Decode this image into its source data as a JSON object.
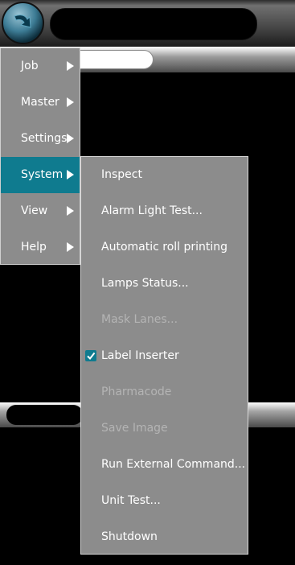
{
  "menu": {
    "items": [
      {
        "label": "Job"
      },
      {
        "label": "Master"
      },
      {
        "label": "Settings"
      },
      {
        "label": "System",
        "active": true
      },
      {
        "label": "View"
      },
      {
        "label": "Help"
      }
    ]
  },
  "submenu": {
    "items": [
      {
        "label": "Inspect",
        "enabled": true
      },
      {
        "label": "Alarm Light Test...",
        "enabled": true
      },
      {
        "label": "Automatic roll printing",
        "enabled": true
      },
      {
        "label": "Lamps Status...",
        "enabled": true
      },
      {
        "label": "Mask Lanes...",
        "enabled": false
      },
      {
        "label": "Label Inserter",
        "enabled": true,
        "checked": true
      },
      {
        "label": "Pharmacode",
        "enabled": false
      },
      {
        "label": "Save Image",
        "enabled": false
      },
      {
        "label": "Run External Command...",
        "enabled": true
      },
      {
        "label": "Unit Test...",
        "enabled": true
      },
      {
        "label": "Shutdown",
        "enabled": true
      }
    ]
  },
  "colors": {
    "accent": "#0f7b8f",
    "menu_bg": "#8c8c8c",
    "disabled_text": "#b4b4b4"
  },
  "icons": {
    "logo": "circular-arrow-logo-icon",
    "submenu_arrow": "triangle-right-icon",
    "checkmark": "checkmark-icon"
  }
}
